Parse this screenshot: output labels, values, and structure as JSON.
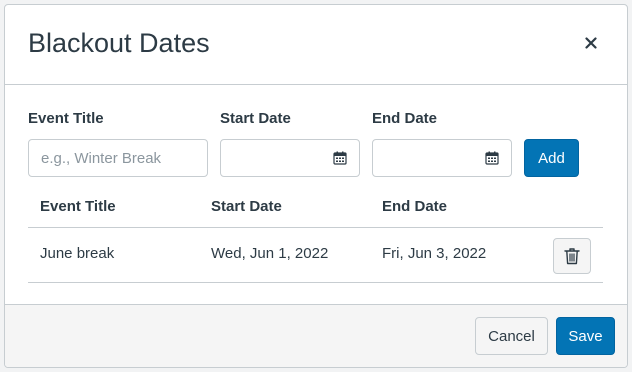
{
  "dialog": {
    "title": "Blackout Dates",
    "close_icon": "close-icon"
  },
  "form": {
    "event_title_label": "Event Title",
    "event_title_placeholder": "e.g., Winter Break",
    "event_title_value": "",
    "start_date_label": "Start Date",
    "start_date_value": "",
    "end_date_label": "End Date",
    "end_date_value": "",
    "add_label": "Add",
    "calendar_icon": "calendar-icon"
  },
  "table": {
    "headers": [
      "Event Title",
      "Start Date",
      "End Date"
    ],
    "rows": [
      {
        "title": "June break",
        "start": "Wed, Jun 1, 2022",
        "end": "Fri, Jun 3, 2022",
        "delete_icon": "trash-icon"
      }
    ]
  },
  "footer": {
    "cancel_label": "Cancel",
    "save_label": "Save"
  },
  "colors": {
    "primary": "#0374b5",
    "text": "#2d3b45",
    "border": "#c7cdd1",
    "footer_bg": "#f5f5f5"
  }
}
